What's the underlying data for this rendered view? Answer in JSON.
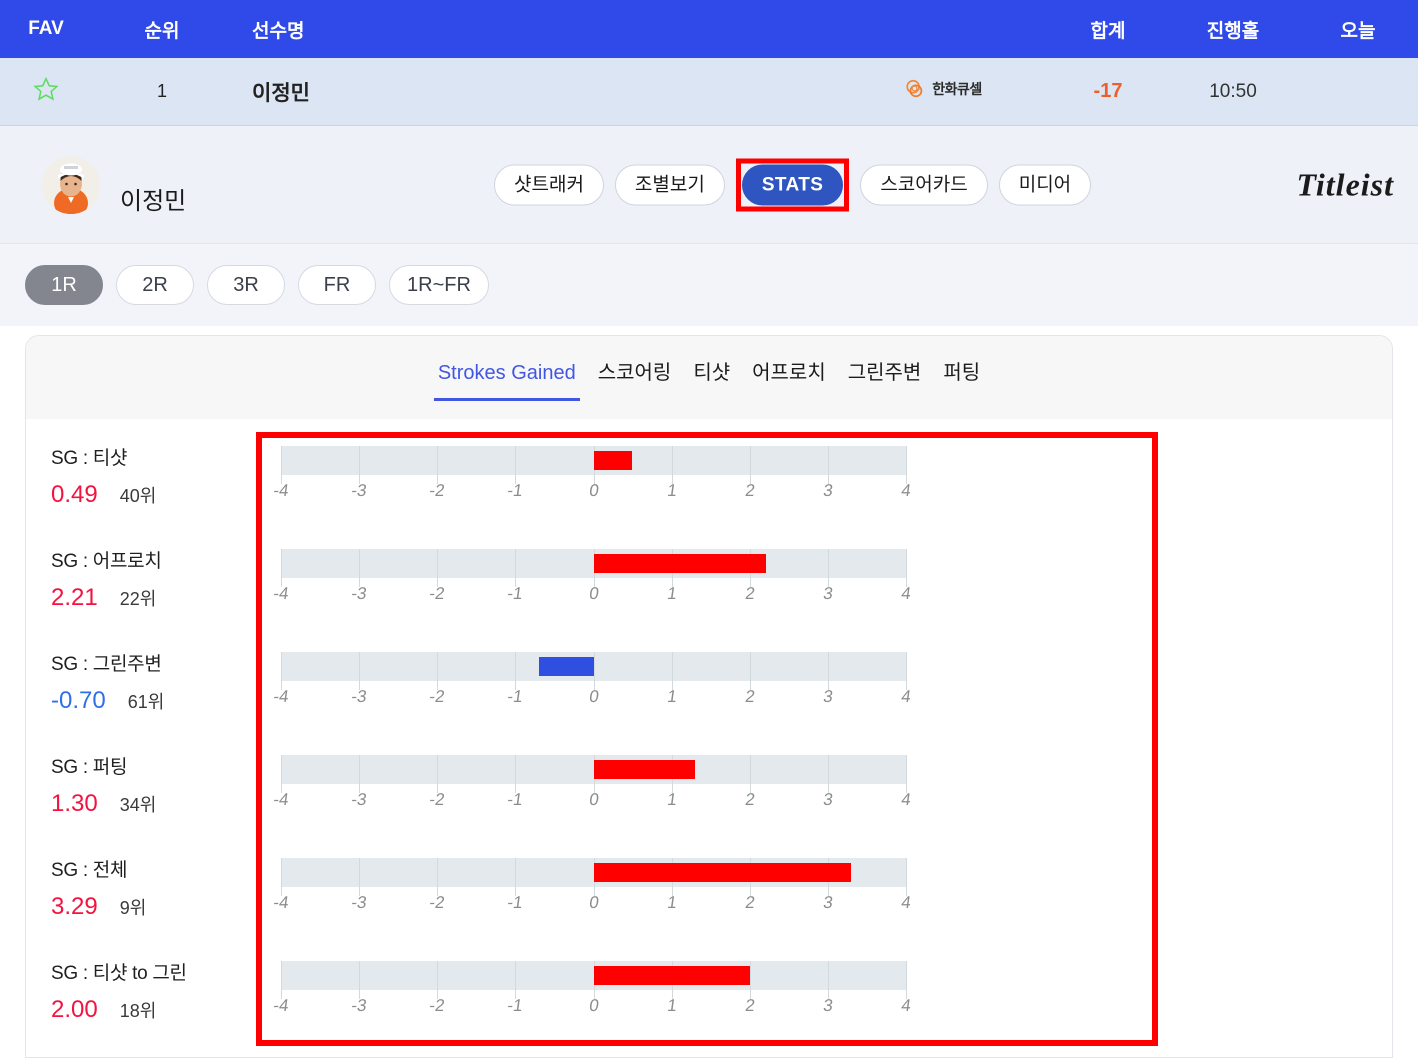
{
  "leaderboard": {
    "columns": {
      "fav": "FAV",
      "rank": "순위",
      "player": "선수명",
      "total": "합계",
      "holes": "진행홀",
      "today": "오늘"
    },
    "row": {
      "fav_icon": "star-outline-icon",
      "rank": "1",
      "player": "이정민",
      "sponsor": "한화큐셀",
      "total": "-17",
      "holes": "10:50",
      "today": ""
    }
  },
  "player": {
    "name": "이정민",
    "avatar_icon": "player-avatar",
    "brand": "Titleist",
    "nav": [
      {
        "label": "샷트래커",
        "active": false
      },
      {
        "label": "조별보기",
        "active": false
      },
      {
        "label": "STATS",
        "active": true,
        "highlighted": true
      },
      {
        "label": "스코어카드",
        "active": false
      },
      {
        "label": "미디어",
        "active": false
      }
    ]
  },
  "rounds": [
    {
      "label": "1R",
      "selected": true
    },
    {
      "label": "2R",
      "selected": false
    },
    {
      "label": "3R",
      "selected": false
    },
    {
      "label": "FR",
      "selected": false
    },
    {
      "label": "1R~FR",
      "selected": false
    }
  ],
  "stat_tabs": [
    {
      "label": "Strokes Gained",
      "active": true
    },
    {
      "label": "스코어링",
      "active": false
    },
    {
      "label": "티샷",
      "active": false
    },
    {
      "label": "어프로치",
      "active": false
    },
    {
      "label": "그린주변",
      "active": false
    },
    {
      "label": "퍼팅",
      "active": false
    }
  ],
  "colors": {
    "header_blue": "#2f4ae8",
    "row_blue": "#dbe5f3",
    "positive_red": "#f4123f",
    "bar_red": "#ff0000",
    "negative_blue": "#2f6fe8",
    "bar_blue": "#2f4fe0",
    "accent_tab": "#4257e0",
    "score_orange": "#ee5d2a",
    "track_gray": "#e3e9ec",
    "highlight_box": "#ff0000"
  },
  "chart_data": {
    "type": "bar",
    "title": "Strokes Gained",
    "orientation": "horizontal",
    "xlim": [
      -4,
      4
    ],
    "xticks": [
      "-4",
      "-3",
      "-2",
      "-1",
      "0",
      "1",
      "2",
      "3",
      "4"
    ],
    "grid": true,
    "baseline": 0,
    "categories": [
      "SG : 티샷",
      "SG : 어프로치",
      "SG : 그린주변",
      "SG : 퍼팅",
      "SG : 전체",
      "SG : 티샷 to 그린"
    ],
    "values": [
      0.49,
      2.21,
      -0.7,
      1.3,
      3.29,
      2.0
    ],
    "value_labels": [
      "0.49",
      "2.21",
      "-0.70",
      "1.30",
      "3.29",
      "2.00"
    ],
    "ranks": [
      "40위",
      "22위",
      "61위",
      "34위",
      "9위",
      "18위"
    ],
    "rows": [
      {
        "label": "SG : 티샷",
        "value": 0.49,
        "value_label": "0.49",
        "rank": "40위",
        "sign": "pos"
      },
      {
        "label": "SG : 어프로치",
        "value": 2.21,
        "value_label": "2.21",
        "rank": "22위",
        "sign": "pos"
      },
      {
        "label": "SG : 그린주변",
        "value": -0.7,
        "value_label": "-0.70",
        "rank": "61위",
        "sign": "neg"
      },
      {
        "label": "SG : 퍼팅",
        "value": 1.3,
        "value_label": "1.30",
        "rank": "34위",
        "sign": "pos"
      },
      {
        "label": "SG : 전체",
        "value": 3.29,
        "value_label": "3.29",
        "rank": "9위",
        "sign": "pos"
      },
      {
        "label": "SG : 티샷 to 그린",
        "value": 2.0,
        "value_label": "2.00",
        "rank": "18위",
        "sign": "pos"
      }
    ]
  }
}
